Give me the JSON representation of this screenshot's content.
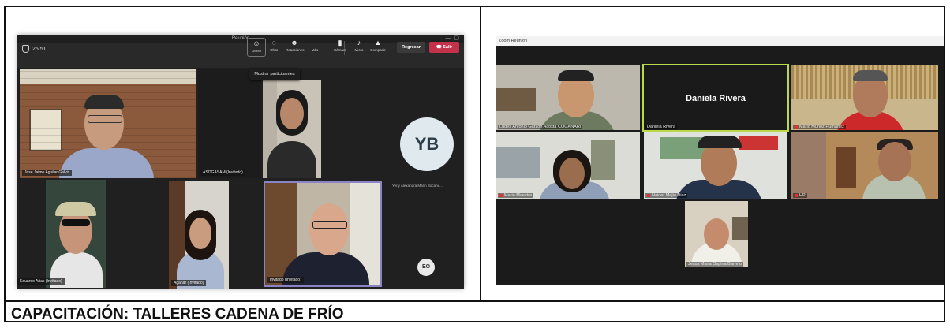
{
  "caption": "CAPACITACIÓN: TALLERES CADENA DE FRÍO",
  "teams": {
    "window_title": "Reunión",
    "timer": "25:51",
    "toolbar": {
      "people": "Gente",
      "chat": "Chat",
      "reactions": "Reacciones",
      "more": "Más",
      "camera": "Cámara",
      "mic": "Micro",
      "share": "Compartir",
      "return": "Regresar",
      "leave": "Salir"
    },
    "tooltip": "Mostrar participantes",
    "participants": [
      {
        "name": "Jose Jaime Aguilar Galvis"
      },
      {
        "name": "ASOGASAM (Invitado)"
      },
      {
        "name": "Yeny Alexandra Marin Bocane..."
      },
      {
        "name": "Eduardo Arias (Invitado)"
      },
      {
        "name": "Aganar (Invitado)"
      },
      {
        "name": "Invitado (Invitado)"
      }
    ],
    "avatars": {
      "yb": "YB",
      "eo": "EO"
    }
  },
  "zoom": {
    "window_title": "Zoom Reunión",
    "participants": [
      {
        "name": "Ludes Antonio Garzon Acosta COGANARI"
      },
      {
        "name": "Daniela Rivera",
        "display": "Daniela Rivera"
      },
      {
        "name": "Mario Muñoz Humanez"
      },
      {
        "name": "Maria Maestre"
      },
      {
        "name": "Naider Mejia Diaz"
      },
      {
        "name": "HP"
      },
      {
        "name": "Jesus Maria Ospina Barreto"
      }
    ]
  }
}
